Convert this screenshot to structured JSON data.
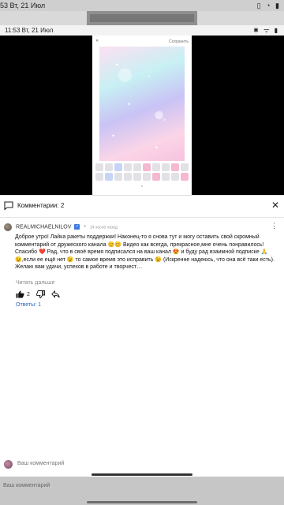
{
  "outer_status": {
    "time": "53  Вт, 21 Июл",
    "icons": "▯ ◔ ▮"
  },
  "inner_status": {
    "time": "11:53  Вт, 21 Июл",
    "icons": "✱ ᯤ ▮"
  },
  "video": {
    "close_glyph": "✕",
    "save_label": "Сохранить",
    "nav_glyph": "⌃"
  },
  "comments_header": {
    "title": "Комментарии: 2",
    "close_glyph": "✕"
  },
  "comment": {
    "author": "REALMICHAELNILOV",
    "verified_glyph": "✓",
    "time": "14 часов назад",
    "text": "Доброе утро! Лайка ракеты поддержки! Наконец-то я снова тут и могу оставить свой скромный комментарий от дружеского канала 😊😊 Видео как всегда, прекрасное,мне очень понравилось! Спасибо ❤️ Рад, что в своё время подписался на ваш канал 😍 и буду рад взаимной подписке 🙏😉,если ее ещё нет 😉 то самое время это исправить 😉 (Искренне надеюсь, что она всё таки есть). Желаю вам удачи, успехов в работе и творчест…",
    "read_more": "Читать дальше",
    "likes": "2",
    "replies": "Ответы: 1",
    "more_glyph": "⋮"
  },
  "footer": {
    "placeholder": "Ваш комментарий",
    "bottom_placeholder": "Ваш комментарий"
  },
  "colors": {
    "link": "#2b62c4",
    "verified": "#3e7ae2"
  }
}
